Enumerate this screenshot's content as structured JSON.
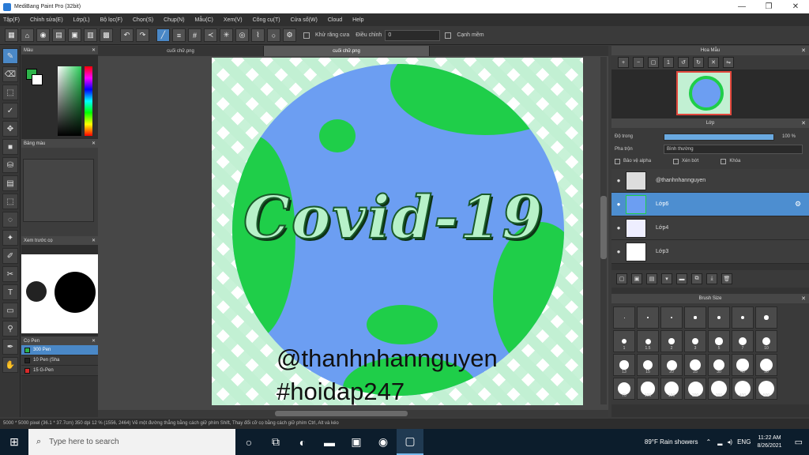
{
  "window": {
    "title": "MediBang Paint Pro (32bit)",
    "controls": [
      "—",
      "❐",
      "✕"
    ]
  },
  "menu": [
    "Tập(F)",
    "Chỉnh sửa(E)",
    "Lớp(L)",
    "Bộ lọc(F)",
    "Chọn(S)",
    "Chụp(N)",
    "Mẫu(C)",
    "Xem(V)",
    "Công cụ(T)",
    "Cửa sổ(W)",
    "Cloud",
    "Help"
  ],
  "toolbar": {
    "snap_label": "Khử răng cưa",
    "correction_label": "Điều chỉnh",
    "correction_value": "0",
    "extra_label": "Cạnh mềm"
  },
  "left_panels": {
    "color_title": "Màu",
    "palette_title": "Bảng màu",
    "navigator_title": "Xem trước cọ",
    "brush_title": "Cọ Pen",
    "brushes": [
      {
        "size": "300",
        "name": "Pen",
        "color": "#2db34a",
        "selected": true
      },
      {
        "size": "10",
        "name": "Pen (Sha",
        "color": "#222222",
        "selected": false
      },
      {
        "size": "15",
        "name": "G-Pen",
        "color": "#d82a2a",
        "selected": false
      }
    ]
  },
  "canvas": {
    "tabs": [
      {
        "label": "cuối chữ.png",
        "selected": false
      },
      {
        "label": "cuối chữ.png",
        "selected": true
      }
    ],
    "art": {
      "main_text": "Covid-19",
      "handle": "@thanhnhannguyen",
      "hashtag": "#hoidap247"
    }
  },
  "right_panels": {
    "navigator_title": "Hoa Mẫu",
    "layer_title": "Lớp",
    "opacity_label": "Độ trong",
    "opacity_value": "100 %",
    "opacity_level": 1.0,
    "blend_label": "Pha trộn",
    "blend_value": "Bình thường",
    "checks": [
      "Bảo vệ alpha",
      "Xén bớt",
      "Khóa"
    ],
    "layers": [
      {
        "name": "@thanhnhannguyen",
        "selected": false
      },
      {
        "name": "Lớp6",
        "selected": true
      },
      {
        "name": "Lớp4",
        "selected": false
      },
      {
        "name": "Lớp3",
        "selected": false
      }
    ],
    "brush_size_title": "Brush Size",
    "brush_sizes": [
      "",
      "",
      "",
      "",
      "",
      "",
      "",
      "1",
      "1.5",
      "2",
      "3",
      "5",
      "7",
      "10",
      "13",
      "15",
      "20",
      "25",
      "30",
      "40",
      "50",
      "70",
      "100",
      "150",
      "200",
      "300",
      "400",
      "500"
    ]
  },
  "status": {
    "text": "5000 * 5000 pixel   (36.1 * 37.7cm)   350 dpi   12 %   (1556, 2464)   Vẽ một đường thẳng bằng cách giữ phím Shift, Thay đổi cỡ cọ bằng cách giữ phím Ctrl, Alt và kéo"
  },
  "taskbar": {
    "search_placeholder": "Type here to search",
    "weather": "89°F  Rain showers",
    "lang": "ENG",
    "time": "11:22 AM",
    "date": "8/26/2021"
  }
}
